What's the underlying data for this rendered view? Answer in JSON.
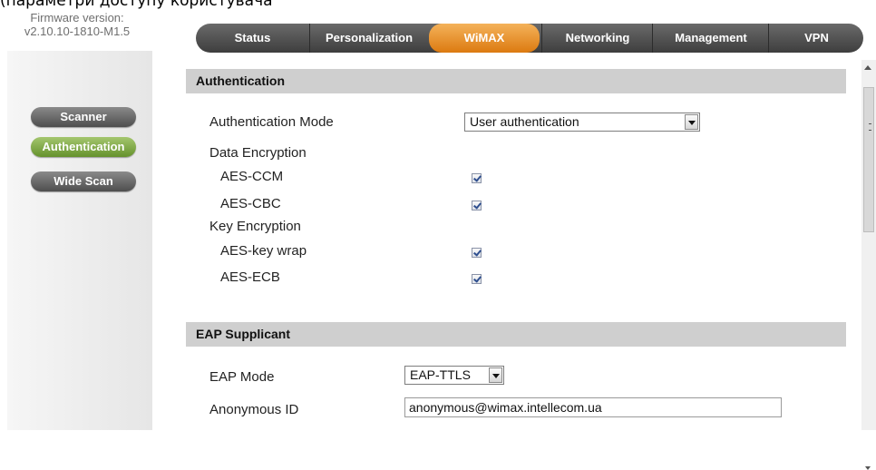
{
  "caption": "(параметри доступу користувача).",
  "firmware": {
    "label": "Firmware version:",
    "value": "v2.10.10-1810-M1.5"
  },
  "sidebar": {
    "items": [
      {
        "label": "Scanner",
        "active": false
      },
      {
        "label": "Authentication",
        "active": true
      },
      {
        "label": "Wide Scan",
        "active": false
      }
    ]
  },
  "tabs": [
    {
      "label": "Status",
      "active": false
    },
    {
      "label": "Personalization",
      "active": false
    },
    {
      "label": "WiMAX",
      "active": true
    },
    {
      "label": "Networking",
      "active": false
    },
    {
      "label": "Management",
      "active": false
    },
    {
      "label": "VPN",
      "active": false
    }
  ],
  "authentication": {
    "header": "Authentication",
    "mode_label": "Authentication Mode",
    "mode_value": "User authentication",
    "data_encryption_label": "Data Encryption",
    "aes_ccm_label": "AES-CCM",
    "aes_ccm_checked": true,
    "aes_cbc_label": "AES-CBC",
    "aes_cbc_checked": true,
    "key_encryption_label": "Key Encryption",
    "aes_keywrap_label": "AES-key wrap",
    "aes_keywrap_checked": true,
    "aes_ecb_label": "AES-ECB",
    "aes_ecb_checked": true
  },
  "eap": {
    "header": "EAP Supplicant",
    "mode_label": "EAP Mode",
    "mode_value": "EAP-TTLS",
    "anon_label": "Anonymous ID",
    "anon_value": "anonymous@wimax.intellecom.ua"
  },
  "colors": {
    "tab_active": "#e8921e",
    "sidebar_active": "#7fa84a",
    "button_dark": "#5a5a5a",
    "section_header": "#cfcfcf"
  }
}
